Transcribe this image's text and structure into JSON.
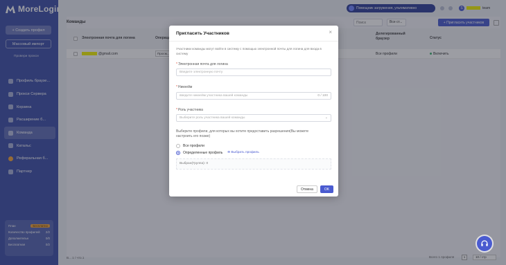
{
  "app": {
    "name": "MoreLogin"
  },
  "sidebar": {
    "create_label": "+ Создать профил",
    "import_label": "Массовый импорт",
    "import_sub": "Провери прокси",
    "items": [
      {
        "label": "Профиль браузе..."
      },
      {
        "label": "Прокси Сервера"
      },
      {
        "label": "Корзина"
      },
      {
        "label": "Расширение б..."
      },
      {
        "label": "Команда"
      },
      {
        "label": "Катальс"
      },
      {
        "label": "Реферальная б..."
      },
      {
        "label": "Партнер"
      }
    ],
    "plan": {
      "label": "План",
      "tag": "Бесплатно",
      "row1": "Количество профилей",
      "row1_val": "2/2",
      "row2": "Дополнительн",
      "row2_val": "0/0",
      "row3": "Бесплатная",
      "row3_val": "0/2"
    }
  },
  "header": {
    "promo": "Помощник загружения, ультимативно",
    "avatar_letter": "S",
    "user_suffix": "team"
  },
  "content": {
    "title": "Команды",
    "search_placeholder": "Поиск",
    "filter_value": "Все ст...",
    "invite_label": "+ Пригласить участников",
    "columns": {
      "email": "Электронная почта для логина",
      "ops": "Операции",
      "delegated": "Делегированный браузер",
      "status": "Статус"
    },
    "row": {
      "email": "@gmail.com",
      "ops_value": "Просм...",
      "delegated": "Все профили",
      "status": "Включить"
    },
    "footer_left": "В... 1 / что.1",
    "pager": "Всего 1 профиля",
    "page_num": "1",
    "per_page": "10 / стр"
  },
  "modal": {
    "title": "Пригласить Участников",
    "close": "×",
    "description": "Участники команды могут войти в систему с помощью электронной почты для логина для входа в систему",
    "email_label": "Электронная почта для логина",
    "email_placeholder": "Введите электронную почту",
    "nickname_label": "Никнейм",
    "nickname_placeholder": "введите никнейм участника вашей команды",
    "nickname_count": "0 / 100",
    "role_label": "Роль участника",
    "role_placeholder": "Выберите роль участника вашей команды",
    "profiles_note": "Выберите профили, для которых вы хотите предоставить разрешения(Вы можете настроить его позже)",
    "radio_all": "Все профили",
    "radio_specific": "Определенные профиль",
    "select_profiles": "⊕ Выбрать профиль",
    "selected": "Выбран(Группа): 0",
    "cancel": "Отмена",
    "ok": "OK"
  },
  "colors": {
    "sidebar": "#3d4fa8",
    "primary": "#4a5bd0",
    "accent": "#f2a53a",
    "highlight": "#f2f200"
  },
  "icons": [
    "logo-icon",
    "close-icon",
    "chevron-down-icon",
    "headset-icon",
    "refresh-icon"
  ]
}
